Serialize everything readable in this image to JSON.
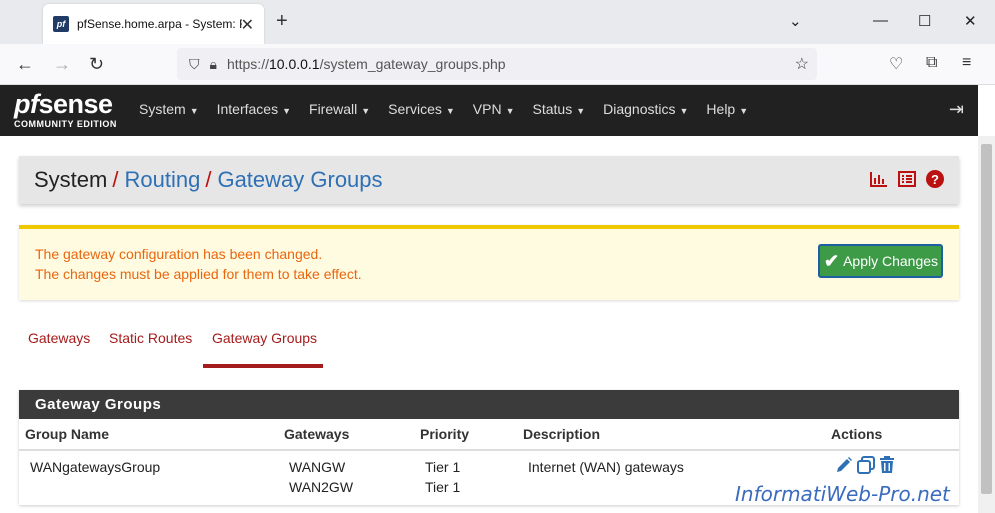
{
  "browser": {
    "tab_title": "pfSense.home.arpa - System: R",
    "favicon_text": "pf",
    "url_prefix": "https://",
    "url_host": "10.0.0.1",
    "url_path": "/system_gateway_groups.php"
  },
  "navbar": {
    "logo_main_pf": "pf",
    "logo_main_rest": "sense",
    "logo_sub": "COMMUNITY EDITION",
    "items": [
      {
        "label": "System"
      },
      {
        "label": "Interfaces"
      },
      {
        "label": "Firewall"
      },
      {
        "label": "Services"
      },
      {
        "label": "VPN"
      },
      {
        "label": "Status"
      },
      {
        "label": "Diagnostics"
      },
      {
        "label": "Help"
      }
    ]
  },
  "breadcrumb": {
    "root": "System",
    "middle": "Routing",
    "current": "Gateway Groups",
    "separator": "/"
  },
  "alert": {
    "line1": "The gateway configuration has been changed.",
    "line2": "The changes must be applied for them to take effect.",
    "apply_label": "Apply Changes"
  },
  "tabs": [
    {
      "label": "Gateways"
    },
    {
      "label": "Static Routes"
    },
    {
      "label": "Gateway Groups"
    }
  ],
  "panel": {
    "title": "Gateway Groups",
    "columns": [
      "Group Name",
      "Gateways",
      "Priority",
      "Description",
      "Actions"
    ],
    "rows": [
      {
        "group_name": "WANgatewaysGroup",
        "gateways": [
          "WANGW",
          "WAN2GW"
        ],
        "priorities": [
          "Tier 1",
          "Tier 1"
        ],
        "description": "Internet (WAN) gateways"
      }
    ]
  },
  "watermark": "InformatiWeb-Pro.net",
  "colors": {
    "accent_red": "#a51c1c",
    "link_blue": "#2e70b5",
    "alert_text": "#e8660f",
    "apply_green": "#3d9b47"
  }
}
